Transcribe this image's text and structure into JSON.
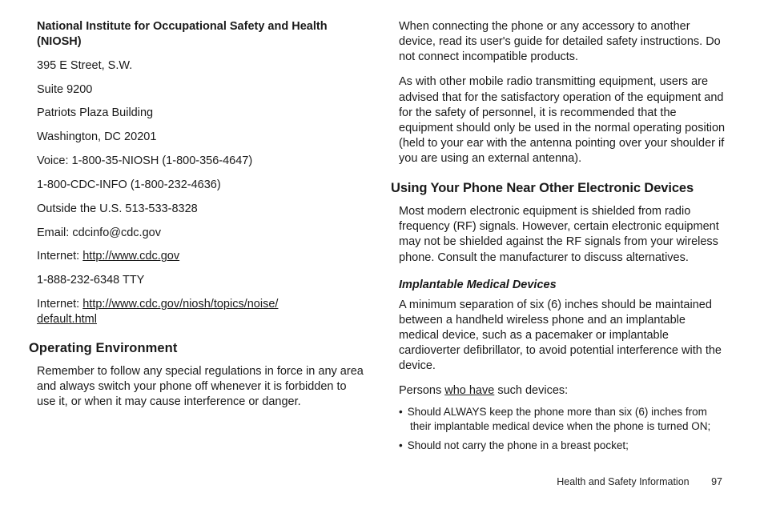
{
  "left": {
    "contact": {
      "title": "National Institute for Occupational Safety and Health (NIOSH)",
      "street": "395 E Street, S.W.",
      "suite": "Suite 9200",
      "building": "Patriots Plaza Building",
      "city": "Washington, DC 20201",
      "voice": "Voice: 1-800-35-NIOSH (1-800-356-4647)",
      "cdcinfo": "1-800-CDC-INFO (1-800-232-4636)",
      "outside": "Outside the U.S. 513-533-8328",
      "email": "Email: cdcinfo@cdc.gov",
      "inet1_label": "Internet: ",
      "inet1_url": "http://www.cdc.gov",
      "tty": "1-888-232-6348 TTY",
      "inet2_label": "Internet: ",
      "inet2_url_line1": "http://www.cdc.gov/niosh/topics/noise/",
      "inet2_url_line2": "default.html"
    },
    "h2_op_env": "Operating Environment",
    "p_op_env": "Remember to follow any special regulations in force in any area and always switch your phone off whenever it is forbidden to use it, or when it may cause interference or danger."
  },
  "right": {
    "p_connect": "When connecting the phone or any accessory to another device, read its user's guide for detailed safety instructions. Do not connect incompatible products.",
    "p_radio": "As with other mobile radio transmitting equipment, users are advised that for the satisfactory operation of the equipment and for the safety of personnel, it is recommended that the equipment should only be used in the normal operating position (held to your ear with the antenna pointing over your shoulder if you are using an external antenna).",
    "h2_other_devices": "Using Your Phone Near Other Electronic Devices",
    "p_shielded": "Most modern electronic equipment is shielded from radio frequency (RF) signals. However, certain electronic equipment may not be shielded against the RF signals from your wireless phone. Consult the manufacturer to discuss alternatives.",
    "h3_implant": "Implantable Medical Devices",
    "p_six_inches": "A minimum separation of six (6) inches should be maintained between a handheld wireless phone and an implantable medical device, such as a pacemaker or implantable cardioverter defibrillator, to avoid potential interference with the device.",
    "persons_pre": "Persons ",
    "persons_u": "who have",
    "persons_post": " such devices:",
    "bullets": {
      "b1": "Should ALWAYS keep the phone more than six (6) inches from their implantable medical device when the phone is turned ON;",
      "b2": "Should not carry the phone in a breast pocket;"
    }
  },
  "footer": {
    "section": "Health and Safety Information",
    "page": "97"
  }
}
